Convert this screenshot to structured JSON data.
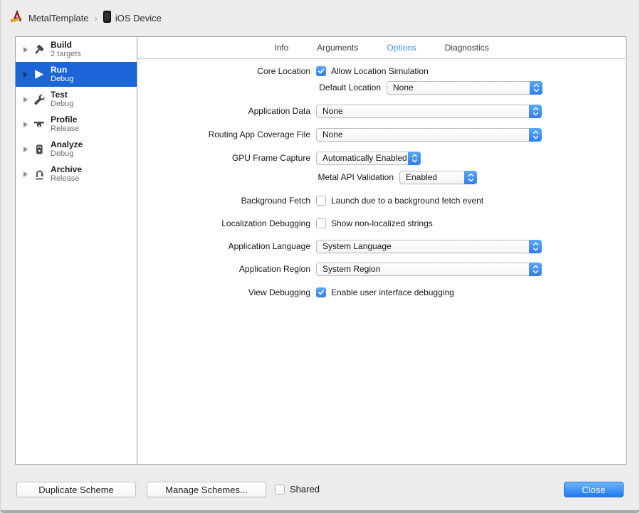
{
  "breadcrumb": {
    "scheme": "MetalTemplate",
    "separator": "›",
    "destination": "iOS Device"
  },
  "sidebar": {
    "items": [
      {
        "label": "Build",
        "subtitle": "2 targets",
        "icon": "hammer-icon",
        "selected": false
      },
      {
        "label": "Run",
        "subtitle": "Debug",
        "icon": "play-icon",
        "selected": true
      },
      {
        "label": "Test",
        "subtitle": "Debug",
        "icon": "wrench-icon",
        "selected": false
      },
      {
        "label": "Profile",
        "subtitle": "Release",
        "icon": "gauge-icon",
        "selected": false
      },
      {
        "label": "Analyze",
        "subtitle": "Debug",
        "icon": "analyze-icon",
        "selected": false
      },
      {
        "label": "Archive",
        "subtitle": "Release",
        "icon": "archive-icon",
        "selected": false
      }
    ]
  },
  "tabs": {
    "active": "Options",
    "items": [
      {
        "label": "Info"
      },
      {
        "label": "Arguments"
      },
      {
        "label": "Options"
      },
      {
        "label": "Diagnostics"
      }
    ]
  },
  "form": {
    "rows": [
      {
        "label": "Core Location",
        "control": "checkbox",
        "checked": true,
        "text": "Allow Location Simulation"
      },
      {
        "label": "Default Location",
        "control": "select",
        "value": "None"
      },
      {
        "label": "Application Data",
        "control": "select",
        "value": "None"
      },
      {
        "label": "Routing App Coverage File",
        "control": "select",
        "value": "None"
      },
      {
        "label": "GPU Frame Capture",
        "control": "select",
        "value": "Automatically Enabled"
      },
      {
        "label": "Metal API Validation",
        "control": "select",
        "value": "Enabled"
      },
      {
        "label": "Background Fetch",
        "control": "checkbox",
        "checked": false,
        "text": "Launch due to a background fetch event"
      },
      {
        "label": "Localization Debugging",
        "control": "checkbox",
        "checked": false,
        "text": "Show non-localized strings"
      },
      {
        "label": "Application Language",
        "control": "select",
        "value": "System Language"
      },
      {
        "label": "Application Region",
        "control": "select",
        "value": "System Region"
      },
      {
        "label": "View Debugging",
        "control": "checkbox",
        "checked": true,
        "text": "Enable user interface debugging"
      }
    ]
  },
  "footer": {
    "duplicate_label": "Duplicate Scheme",
    "manage_label": "Manage Schemes...",
    "shared_label": "Shared",
    "shared_checked": false,
    "close_label": "Close"
  },
  "colors": {
    "selection_blue": "#1b65d9",
    "active_tab_blue": "#3b96f2",
    "control_blue_top": "#5ba8f9",
    "control_blue_bottom": "#2f7ee9",
    "close_button_top": "#6db4f9",
    "close_button_bottom": "#1f78f2",
    "window_chrome": "#ececec"
  }
}
